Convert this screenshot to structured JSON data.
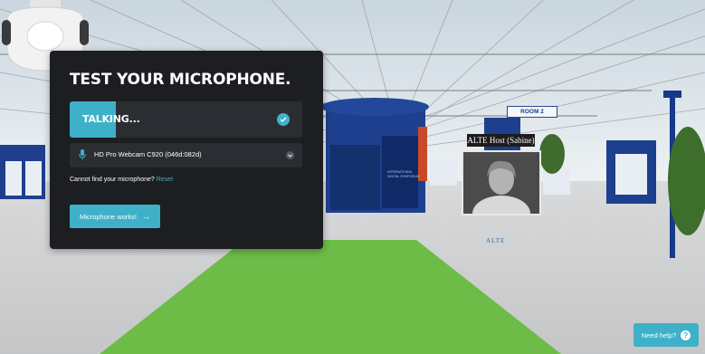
{
  "modal": {
    "title": "TEST YOUR MICROPHONE.",
    "level_label": "TALKING...",
    "level_fraction": 0.2,
    "device": {
      "selected": "HD Pro Webcam C920 (046d:082d)"
    },
    "help_text": "Cannot find your microphone?",
    "reset_link": "Reset",
    "confirm_button": "Microphone works!"
  },
  "scene": {
    "room_sign": "ROOM 2",
    "host_label": "ALTE Host (Sabine)",
    "robot_brand": "ALTE",
    "booth_text": "INTERNATIONAL DIGITAL SYMPOSIUM"
  },
  "help_button": {
    "label": "Need help?",
    "icon": "?"
  },
  "colors": {
    "accent": "#3eb1c8",
    "modal_bg": "#1c1e22",
    "carpet": "#6cbc47",
    "booth_blue": "#1d3f8e"
  }
}
